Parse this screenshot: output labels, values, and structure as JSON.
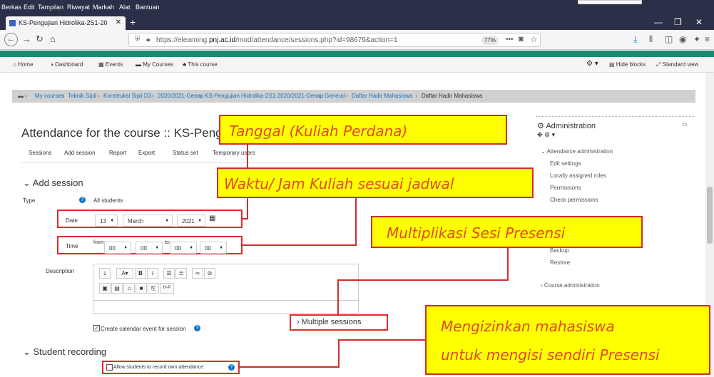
{
  "menubar": {
    "items": [
      "Berkas",
      "Edit",
      "Tampilan",
      "Riwayat",
      "Markah",
      "Alat",
      "Bantuan"
    ]
  },
  "browser": {
    "tab_title": "KS-Pengujian Hidrolika-2S1-20",
    "url_prefix": "https://elearning.",
    "url_domain": "pnj.ac.id",
    "url_path": "/mod/attendance/sessions.php?id=98679&action=1",
    "zoom": "77%"
  },
  "moodle_nav": {
    "home": "Home",
    "dashboard": "Dashboard",
    "events": "Events",
    "my_courses": "My Courses",
    "this_course": "This course",
    "hide_blocks": "Hide blocks",
    "standard_view": "Standard view"
  },
  "breadcrumb": [
    "My courses",
    "Teknik Sipil",
    "Konstruksi Sipil D3",
    "2020/2021-Genap",
    "KS-Pengujian Hidrolika-2S1-2020/2021-Genap",
    "General",
    "Daftar Hadir Mahasiswa",
    "Daftar Hadir Mahasiswa"
  ],
  "page": {
    "heading": "Attendance for the course :: KS-Pengu",
    "tabs": [
      "Sessions",
      "Add session",
      "Report",
      "Export",
      "Status set",
      "Temporary users"
    ]
  },
  "form": {
    "add_session_title": "Add session",
    "type_label": "Type",
    "type_value": "All students",
    "date_label": "Date",
    "date_day": "13",
    "date_month": "March",
    "date_year": "2021",
    "time_label": "Time",
    "from_label": "from:",
    "to_label": "to:",
    "from_hour": "00",
    "from_min": "00",
    "to_hour": "00",
    "to_min": "00",
    "description_label": "Description",
    "calendar_event": "Create calendar event for session",
    "multiple_sessions": "Multiple sessions",
    "student_recording_title": "Student recording",
    "allow_record": "Allow students to record own attendance"
  },
  "admin_block": {
    "title": "Administration",
    "section": "Attendance administration",
    "items": [
      "Edit settings",
      "Locally assigned roles",
      "Permissions",
      "Check permissions"
    ],
    "items2": [
      "Backup",
      "Restore"
    ],
    "course_admin": "Course administration"
  },
  "callouts": {
    "date": "Tanggal (Kuliah Perdana)",
    "time": "Waktu/ Jam Kuliah sesuai jadwal",
    "multiple": "Multiplikasi Sesi Presensi",
    "allow_line1": "Mengizinkan mahasiswa",
    "allow_line2": "untuk mengisi sendiri Presensi"
  },
  "colors": {
    "callout_fill": "#ffff00",
    "callout_border": "#d12d2d",
    "callout_text": "#e0492a",
    "theme_green": "#1a8a73",
    "link_blue": "#1673c4"
  }
}
